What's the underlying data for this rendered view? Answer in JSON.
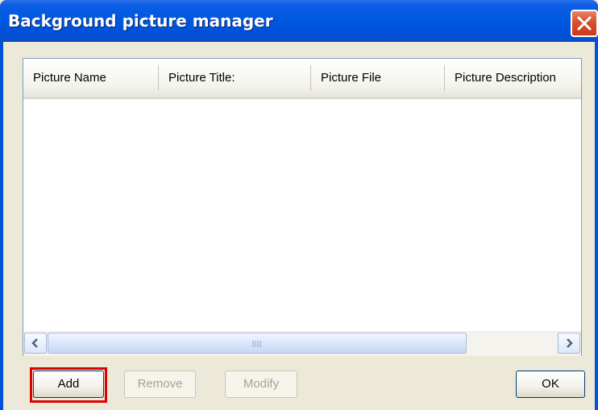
{
  "window": {
    "title": "Background picture manager"
  },
  "list": {
    "columns": [
      "Picture Name",
      "Picture Title:",
      "Picture File",
      "Picture Description"
    ],
    "rows": []
  },
  "buttons": {
    "add": "Add",
    "remove": "Remove",
    "modify": "Modify",
    "ok": "OK"
  },
  "icons": {
    "close": "close-icon",
    "scroll_left": "chevron-left-icon",
    "scroll_right": "chevron-right-icon",
    "scroll_grip": "grip-icon"
  },
  "colors": {
    "titlebar": "#0050d8",
    "close_button": "#d9532f",
    "highlight": "#e00000"
  }
}
